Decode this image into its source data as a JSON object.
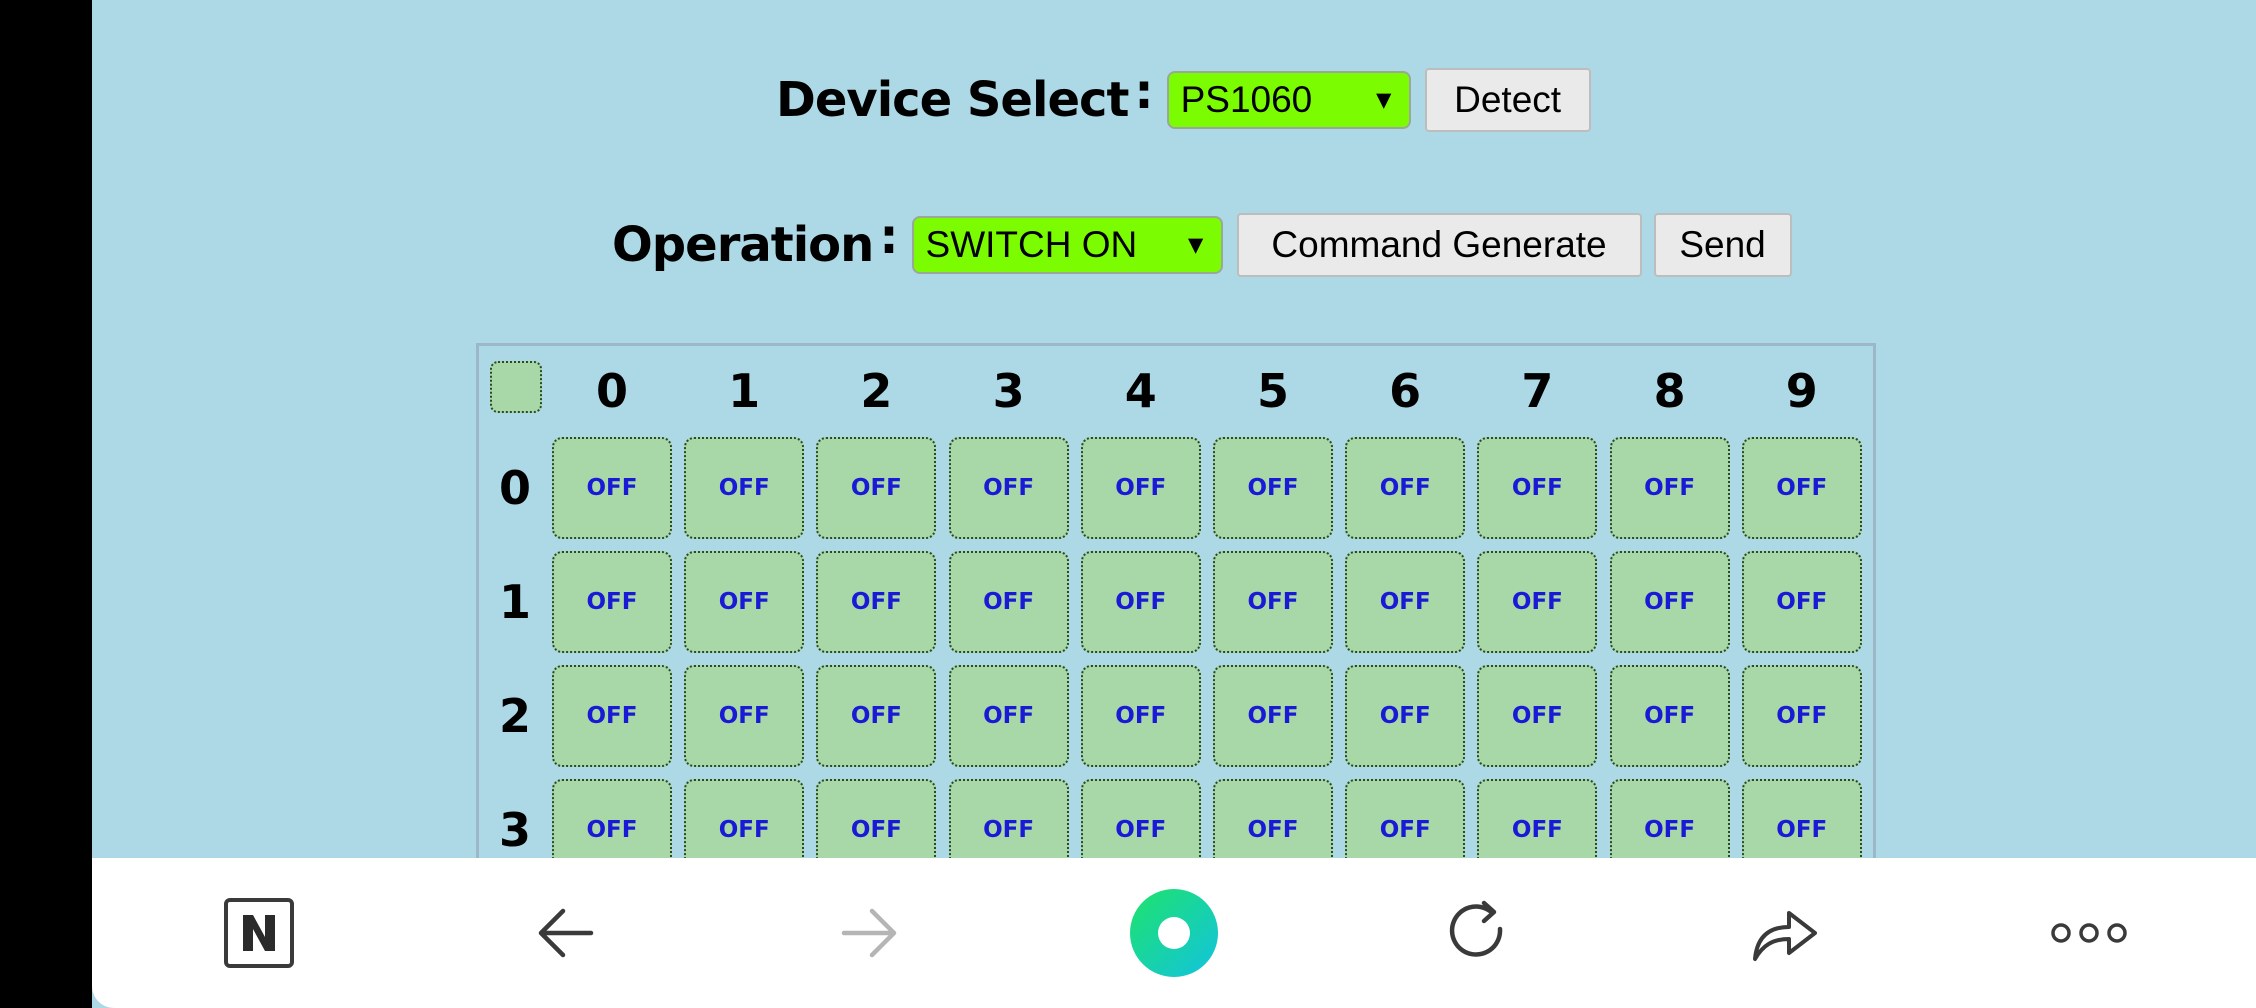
{
  "device": {
    "label": "Device Select",
    "colon": ":",
    "selected": "PS1060",
    "dropdown_icon": "▼",
    "detect_label": "Detect"
  },
  "operation": {
    "label": "Operation",
    "colon": ":",
    "selected": "SWITCH ON",
    "dropdown_icon": "▼",
    "generate_label": "Command Generate",
    "send_label": "Send"
  },
  "grid": {
    "columns": [
      "0",
      "1",
      "2",
      "3",
      "4",
      "5",
      "6",
      "7",
      "8",
      "9"
    ],
    "rows": [
      {
        "label": "0",
        "cells": [
          "OFF",
          "OFF",
          "OFF",
          "OFF",
          "OFF",
          "OFF",
          "OFF",
          "OFF",
          "OFF",
          "OFF"
        ]
      },
      {
        "label": "1",
        "cells": [
          "OFF",
          "OFF",
          "OFF",
          "OFF",
          "OFF",
          "OFF",
          "OFF",
          "OFF",
          "OFF",
          "OFF"
        ]
      },
      {
        "label": "2",
        "cells": [
          "OFF",
          "OFF",
          "OFF",
          "OFF",
          "OFF",
          "OFF",
          "OFF",
          "OFF",
          "OFF",
          "OFF"
        ]
      },
      {
        "label": "3",
        "cells": [
          "OFF",
          "OFF",
          "OFF",
          "OFF",
          "OFF",
          "OFF",
          "OFF",
          "OFF",
          "OFF",
          "OFF"
        ]
      }
    ]
  },
  "navbar": {
    "items": [
      "naver-n-icon",
      "back-arrow-icon",
      "forward-arrow-icon",
      "home-circle-icon",
      "refresh-icon",
      "share-icon",
      "more-dots-icon"
    ]
  },
  "colors": {
    "page_background": "#add8e6",
    "select_background": "#7cfc00",
    "cell_background": "#a8d8a8",
    "cell_text": "#1a1ad6"
  }
}
